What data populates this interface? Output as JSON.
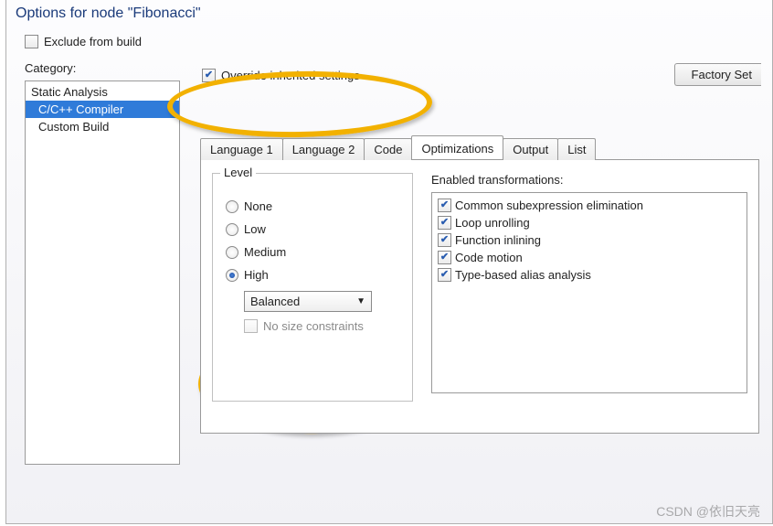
{
  "window": {
    "title": "Options for node \"Fibonacci\""
  },
  "exclude": {
    "label": "Exclude from build",
    "checked": false
  },
  "category": {
    "label": "Category:",
    "items": [
      {
        "label": "Static Analysis",
        "indent": false,
        "selected": false
      },
      {
        "label": "C/C++ Compiler",
        "indent": true,
        "selected": true
      },
      {
        "label": "Custom Build",
        "indent": true,
        "selected": false
      }
    ]
  },
  "override": {
    "label": "Override inherited settings",
    "checked": true
  },
  "factory_btn": "Factory Set",
  "tabs": {
    "items": [
      {
        "label": "Language 1",
        "active": false
      },
      {
        "label": "Language 2",
        "active": false
      },
      {
        "label": "Code",
        "active": false
      },
      {
        "label": "Optimizations",
        "active": true
      },
      {
        "label": "Output",
        "active": false
      },
      {
        "label": "List",
        "active": false
      }
    ]
  },
  "level": {
    "group_title": "Level",
    "options": [
      "None",
      "Low",
      "Medium",
      "High"
    ],
    "selected": "High",
    "combo": "Balanced",
    "no_size": {
      "label": "No size constraints",
      "enabled": false
    }
  },
  "transforms": {
    "label": "Enabled transformations:",
    "items": [
      "Common subexpression elimination",
      "Loop unrolling",
      "Function inlining",
      "Code motion",
      "Type-based alias analysis"
    ]
  },
  "watermark": "CSDN @依旧天亮"
}
